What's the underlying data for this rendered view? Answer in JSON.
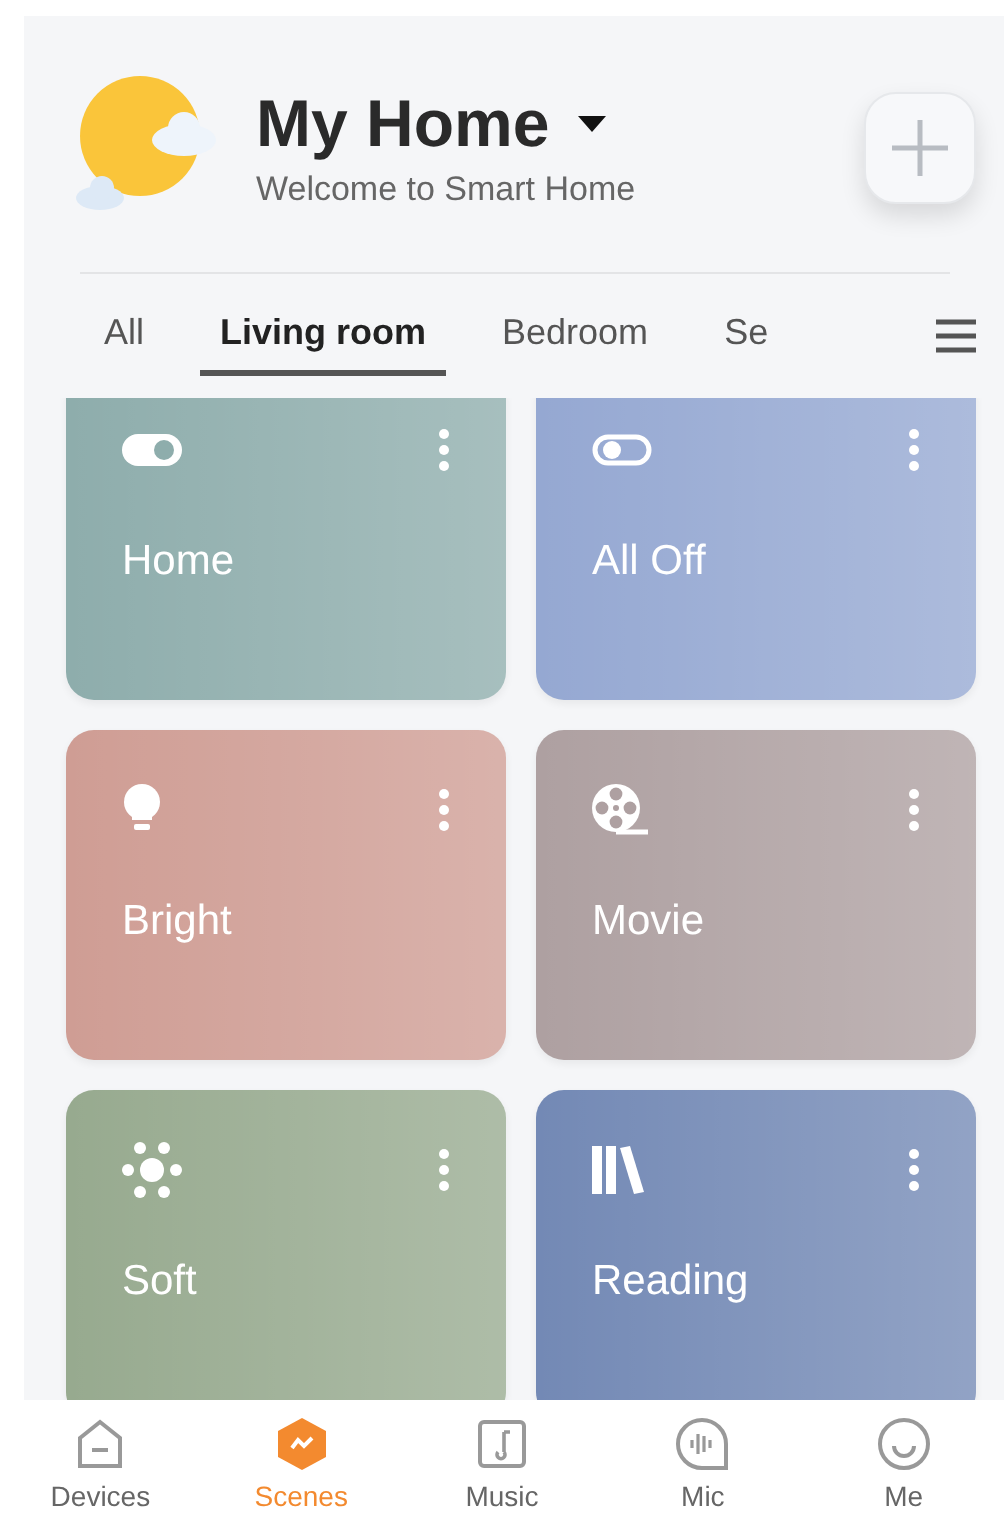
{
  "header": {
    "title": "My Home",
    "subtitle": "Welcome to Smart Home"
  },
  "tabs": [
    {
      "label": "All",
      "selected": false
    },
    {
      "label": "Living room",
      "selected": true
    },
    {
      "label": "Bedroom",
      "selected": false
    },
    {
      "label": "Se",
      "selected": false
    }
  ],
  "scenes": [
    {
      "name": "Home",
      "kind": "toggle",
      "on": true,
      "color": "#8eadac"
    },
    {
      "name": "All Off",
      "kind": "toggle",
      "on": false,
      "color": "#95a8d2"
    },
    {
      "name": "Bright",
      "kind": "bulb",
      "color": "#cf9d94"
    },
    {
      "name": "Movie",
      "kind": "film",
      "color": "#aea0a1"
    },
    {
      "name": "Soft",
      "kind": "dots",
      "color": "#97aa8f"
    },
    {
      "name": "Reading",
      "kind": "books",
      "color": "#7389b5"
    }
  ],
  "bottom_nav": [
    {
      "label": "Devices",
      "kind": "house",
      "selected": false
    },
    {
      "label": "Scenes",
      "kind": "hex",
      "selected": true
    },
    {
      "label": "Music",
      "kind": "note",
      "selected": false
    },
    {
      "label": "Mic",
      "kind": "mic",
      "selected": false
    },
    {
      "label": "Me",
      "kind": "smile",
      "selected": false
    }
  ]
}
